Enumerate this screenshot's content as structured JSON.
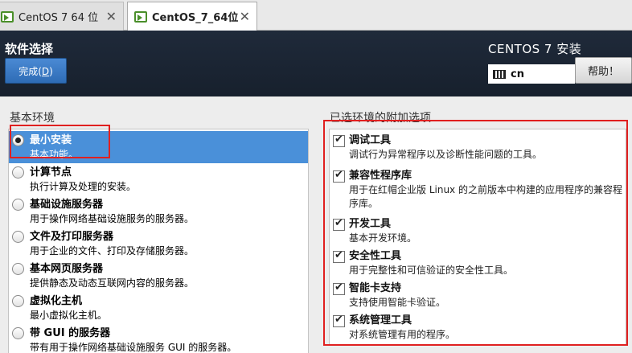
{
  "tabs": [
    {
      "label": "CentOS 7 64 位"
    },
    {
      "label": "CentOS_7_64位"
    }
  ],
  "header": {
    "page_title": "软件选择",
    "done_label": "完成(",
    "done_accel": "D",
    "done_close": ")",
    "product_title": "CENTOS 7 安装",
    "keyboard_layout": "cn",
    "help_label": "帮助！"
  },
  "base_environment": {
    "heading": "基本环境",
    "items": [
      {
        "name": "最小安装",
        "desc": "基本功能。",
        "selected": true
      },
      {
        "name": "计算节点",
        "desc": "执行计算及处理的安装。",
        "selected": false
      },
      {
        "name": "基础设施服务器",
        "desc": "用于操作网络基础设施服务的服务器。",
        "selected": false
      },
      {
        "name": "文件及打印服务器",
        "desc": "用于企业的文件、打印及存储服务器。",
        "selected": false
      },
      {
        "name": "基本网页服务器",
        "desc": "提供静态及动态互联网内容的服务器。",
        "selected": false
      },
      {
        "name": "虚拟化主机",
        "desc": "最小虚拟化主机。",
        "selected": false
      },
      {
        "name": "带 GUI 的服务器",
        "desc": "带有用于操作网络基础设施服务 GUI 的服务器。",
        "selected": false
      }
    ]
  },
  "addons": {
    "heading": "已选环境的附加选项",
    "items": [
      {
        "name": "调试工具",
        "desc": "调试行为异常程序以及诊断性能问题的工具。",
        "checked": true
      },
      {
        "name": "兼容性程序库",
        "desc": "用于在红帽企业版 Linux 的之前版本中构建的应用程序的兼容程序库。",
        "checked": true
      },
      {
        "name": "开发工具",
        "desc": "基本开发环境。",
        "checked": true
      },
      {
        "name": "安全性工具",
        "desc": "用于完整性和可信验证的安全性工具。",
        "checked": true
      },
      {
        "name": "智能卡支持",
        "desc": "支持使用智能卡验证。",
        "checked": true
      },
      {
        "name": "系统管理工具",
        "desc": "对系统管理有用的程序。",
        "checked": true
      }
    ]
  },
  "colors": {
    "header_bg": "#1f2a3a",
    "selection_bg": "#4a90d9",
    "done_button": "#3a7bc8",
    "annotation": "#e02020"
  }
}
